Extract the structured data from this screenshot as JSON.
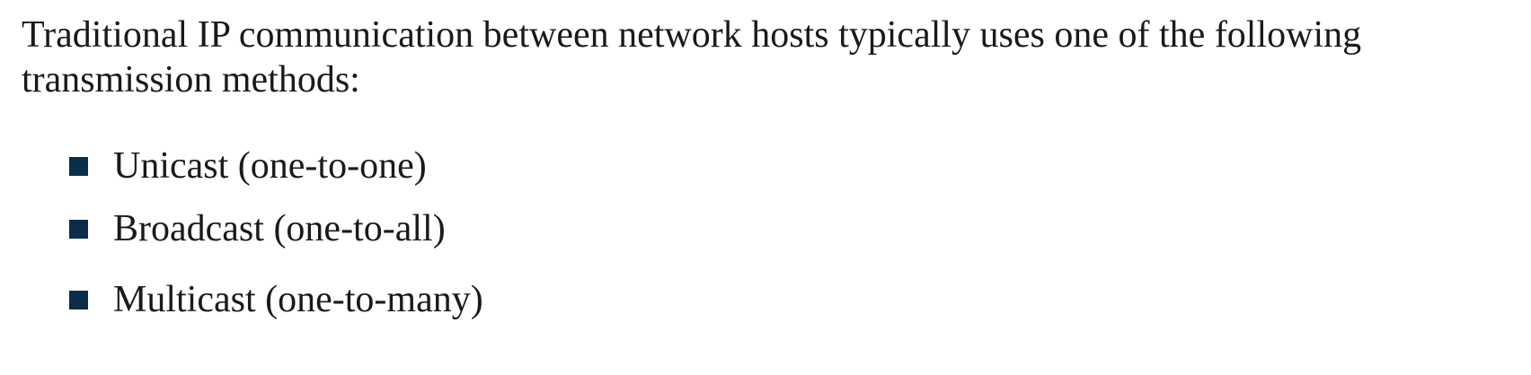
{
  "intro": {
    "text": "Traditional IP communication between network hosts typically uses one of the following transmission methods:"
  },
  "bullets": [
    {
      "label": "Unicast (one-to-one)"
    },
    {
      "label": "Broadcast (one-to-all)"
    },
    {
      "label": "Multicast (one-to-many)"
    }
  ],
  "colors": {
    "text": "#1a1a1a",
    "bullet": "#0c2d4a",
    "background": "#ffffff"
  },
  "icons": {
    "bullet": "square-bullet-icon"
  }
}
